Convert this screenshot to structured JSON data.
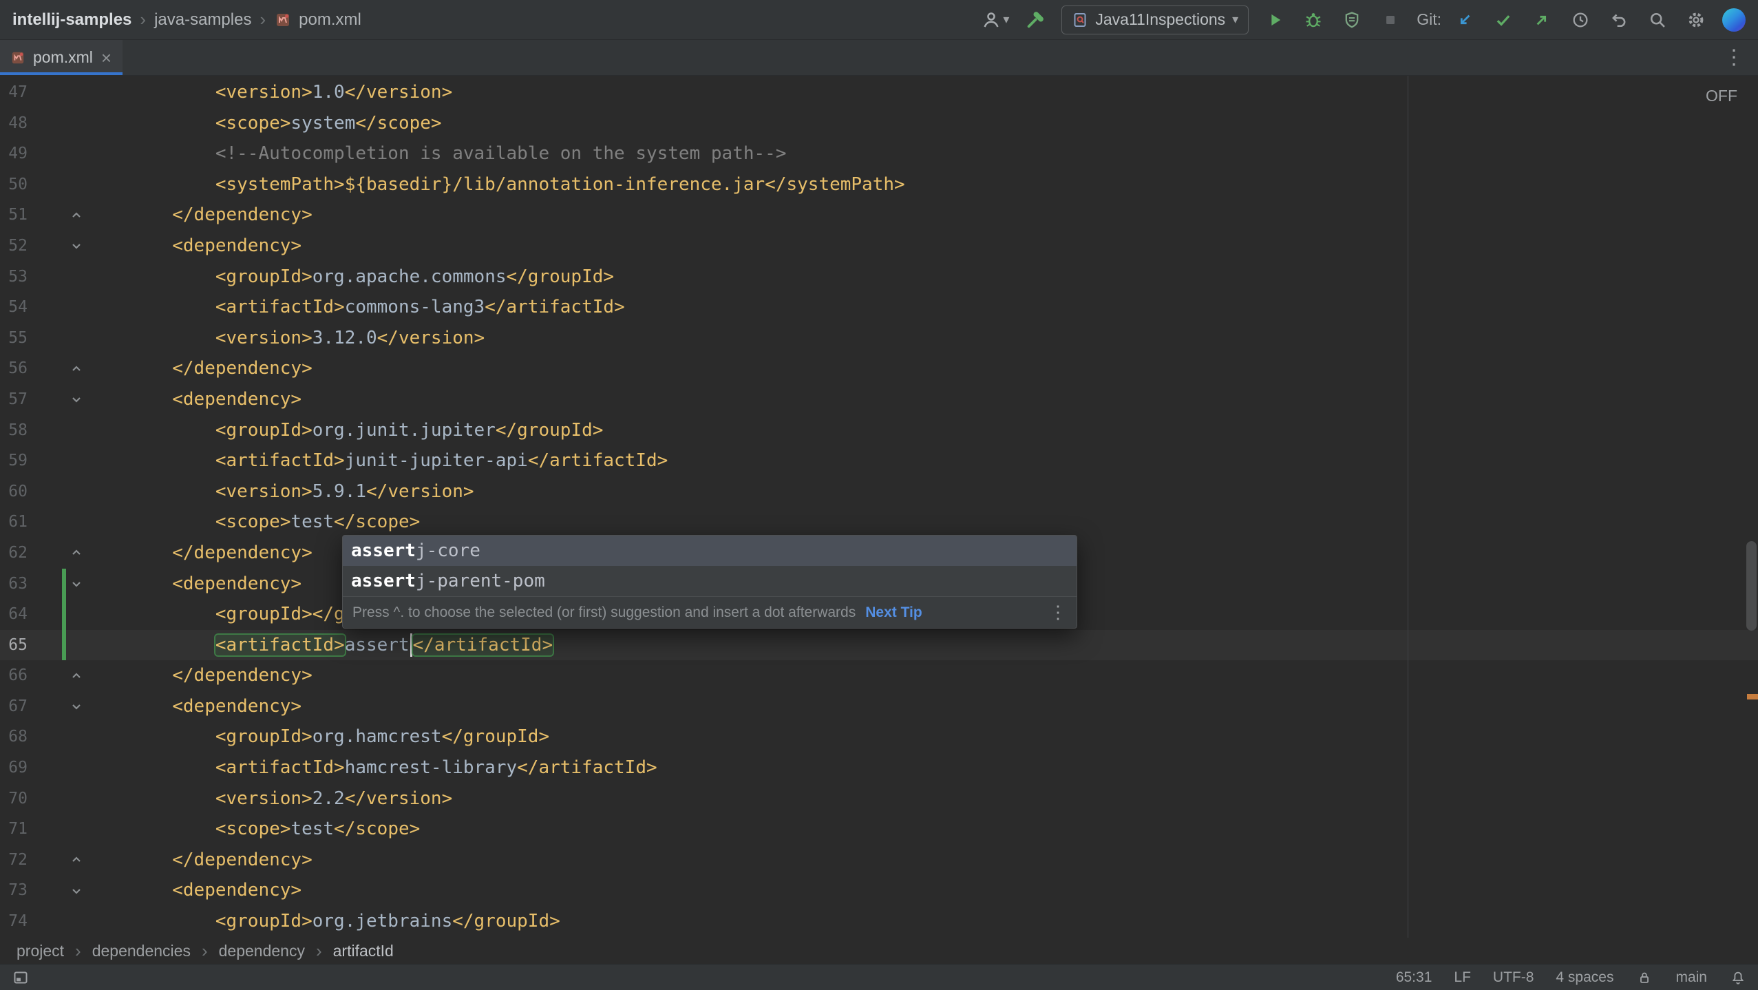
{
  "colors": {
    "chrome": "#333638",
    "editor-bg": "#2b2b2b",
    "tag": "#e8bf6a",
    "text": "#a9b7c6",
    "comment": "#808080",
    "value": "#e8bf6a",
    "line-num": "#606366",
    "accent-blue": "#3674cc",
    "green": "#5fad65",
    "git-blue": "#3b97d3",
    "caret": "#d8d8d8",
    "current-line": "#323232",
    "match-box": "#3e7a46",
    "popup-bg": "#3c3f41",
    "popup-selected": "#4b5059",
    "link": "#548fe3",
    "change-bar": "#499c54",
    "stripe-orange": "#c77d3e"
  },
  "titlebar": {
    "project": "intellij-samples",
    "module": "java-samples",
    "file": "pom.xml",
    "run_config": "Java11Inspections",
    "git_label": "Git:"
  },
  "tabbar": {
    "tab": "pom.xml"
  },
  "editor": {
    "highlighting_badge": "OFF",
    "lines": [
      {
        "n": 47,
        "ind": 12,
        "tok": [
          [
            "<version>",
            "tag"
          ],
          [
            "1.0",
            "txt"
          ],
          [
            "</version>",
            "tag"
          ]
        ]
      },
      {
        "n": 48,
        "ind": 12,
        "tok": [
          [
            "<scope>",
            "tag"
          ],
          [
            "system",
            "txt"
          ],
          [
            "</scope>",
            "tag"
          ]
        ]
      },
      {
        "n": 49,
        "ind": 12,
        "tok": [
          [
            "<!--Autocompletion is available on the system path-->",
            "cmt"
          ]
        ]
      },
      {
        "n": 50,
        "ind": 12,
        "tok": [
          [
            "<systemPath>",
            "tag"
          ],
          [
            "${basedir}/lib/annotation-inference.jar",
            "val"
          ],
          [
            "</systemPath>",
            "tag"
          ]
        ]
      },
      {
        "n": 51,
        "ind": 8,
        "fold": "end",
        "tok": [
          [
            "</dependency>",
            "tag"
          ]
        ]
      },
      {
        "n": 52,
        "ind": 8,
        "fold": "start",
        "tok": [
          [
            "<dependency>",
            "tag"
          ]
        ]
      },
      {
        "n": 53,
        "ind": 12,
        "tok": [
          [
            "<groupId>",
            "tag"
          ],
          [
            "org.apache.commons",
            "txt"
          ],
          [
            "</groupId>",
            "tag"
          ]
        ]
      },
      {
        "n": 54,
        "ind": 12,
        "tok": [
          [
            "<artifactId>",
            "tag"
          ],
          [
            "commons-lang3",
            "txt"
          ],
          [
            "</artifactId>",
            "tag"
          ]
        ]
      },
      {
        "n": 55,
        "ind": 12,
        "tok": [
          [
            "<version>",
            "tag"
          ],
          [
            "3.12.0",
            "txt"
          ],
          [
            "</version>",
            "tag"
          ]
        ]
      },
      {
        "n": 56,
        "ind": 8,
        "fold": "end",
        "tok": [
          [
            "</dependency>",
            "tag"
          ]
        ]
      },
      {
        "n": 57,
        "ind": 8,
        "fold": "start",
        "tok": [
          [
            "<dependency>",
            "tag"
          ]
        ]
      },
      {
        "n": 58,
        "ind": 12,
        "tok": [
          [
            "<groupId>",
            "tag"
          ],
          [
            "org.junit.jupiter",
            "txt"
          ],
          [
            "</groupId>",
            "tag"
          ]
        ]
      },
      {
        "n": 59,
        "ind": 12,
        "tok": [
          [
            "<artifactId>",
            "tag"
          ],
          [
            "junit-jupiter-api",
            "txt"
          ],
          [
            "</artifactId>",
            "tag"
          ]
        ]
      },
      {
        "n": 60,
        "ind": 12,
        "tok": [
          [
            "<version>",
            "tag"
          ],
          [
            "5.9.1",
            "txt"
          ],
          [
            "</version>",
            "tag"
          ]
        ]
      },
      {
        "n": 61,
        "ind": 12,
        "tok": [
          [
            "<scope>",
            "tag"
          ],
          [
            "test",
            "txt"
          ],
          [
            "</scope>",
            "tag"
          ]
        ]
      },
      {
        "n": 62,
        "ind": 8,
        "fold": "end",
        "tok": [
          [
            "</dependency>",
            "tag"
          ]
        ]
      },
      {
        "n": 63,
        "ind": 8,
        "fold": "start",
        "chg": true,
        "tok": [
          [
            "<dependency>",
            "tag"
          ]
        ]
      },
      {
        "n": 64,
        "ind": 12,
        "chg": true,
        "tok": [
          [
            "<groupId>",
            "tag"
          ],
          [
            "</groupId>",
            "tag"
          ]
        ]
      },
      {
        "n": 65,
        "ind": 12,
        "chg": true,
        "cur": true,
        "tok": [
          [
            "<artifactId>",
            "tag boxed"
          ],
          [
            "assert",
            "txt"
          ],
          [
            "",
            "caret"
          ],
          [
            "</artifactId>",
            "tag boxed"
          ]
        ]
      },
      {
        "n": 66,
        "ind": 8,
        "fold": "end",
        "tok": [
          [
            "</dependency>",
            "tag"
          ]
        ]
      },
      {
        "n": 67,
        "ind": 8,
        "fold": "start",
        "tok": [
          [
            "<dependency>",
            "tag"
          ]
        ]
      },
      {
        "n": 68,
        "ind": 12,
        "tok": [
          [
            "<groupId>",
            "tag"
          ],
          [
            "org.hamcrest",
            "txt"
          ],
          [
            "</groupId>",
            "tag"
          ]
        ]
      },
      {
        "n": 69,
        "ind": 12,
        "tok": [
          [
            "<artifactId>",
            "tag"
          ],
          [
            "hamcrest-library",
            "txt"
          ],
          [
            "</artifactId>",
            "tag"
          ]
        ]
      },
      {
        "n": 70,
        "ind": 12,
        "tok": [
          [
            "<version>",
            "tag"
          ],
          [
            "2.2",
            "txt"
          ],
          [
            "</version>",
            "tag"
          ]
        ]
      },
      {
        "n": 71,
        "ind": 12,
        "tok": [
          [
            "<scope>",
            "tag"
          ],
          [
            "test",
            "txt"
          ],
          [
            "</scope>",
            "tag"
          ]
        ]
      },
      {
        "n": 72,
        "ind": 8,
        "fold": "end",
        "tok": [
          [
            "</dependency>",
            "tag"
          ]
        ]
      },
      {
        "n": 73,
        "ind": 8,
        "fold": "start",
        "tok": [
          [
            "<dependency>",
            "tag"
          ]
        ]
      },
      {
        "n": 74,
        "ind": 12,
        "tok": [
          [
            "<groupId>",
            "tag"
          ],
          [
            "org.jetbrains",
            "txt"
          ],
          [
            "</groupId>",
            "tag"
          ]
        ]
      }
    ]
  },
  "completion": {
    "items": [
      {
        "prefix": "assert",
        "rest": "j-core",
        "selected": true
      },
      {
        "prefix": "assert",
        "rest": "j-parent-pom",
        "selected": false
      }
    ],
    "hint": "Press ^. to choose the selected (or first) suggestion and insert a dot afterwards",
    "link": "Next Tip"
  },
  "breadcrumbs": [
    "project",
    "dependencies",
    "dependency",
    "artifactId"
  ],
  "statusbar": {
    "caret": "65:31",
    "line_sep": "LF",
    "encoding": "UTF-8",
    "indent": "4 spaces",
    "branch": "main"
  }
}
